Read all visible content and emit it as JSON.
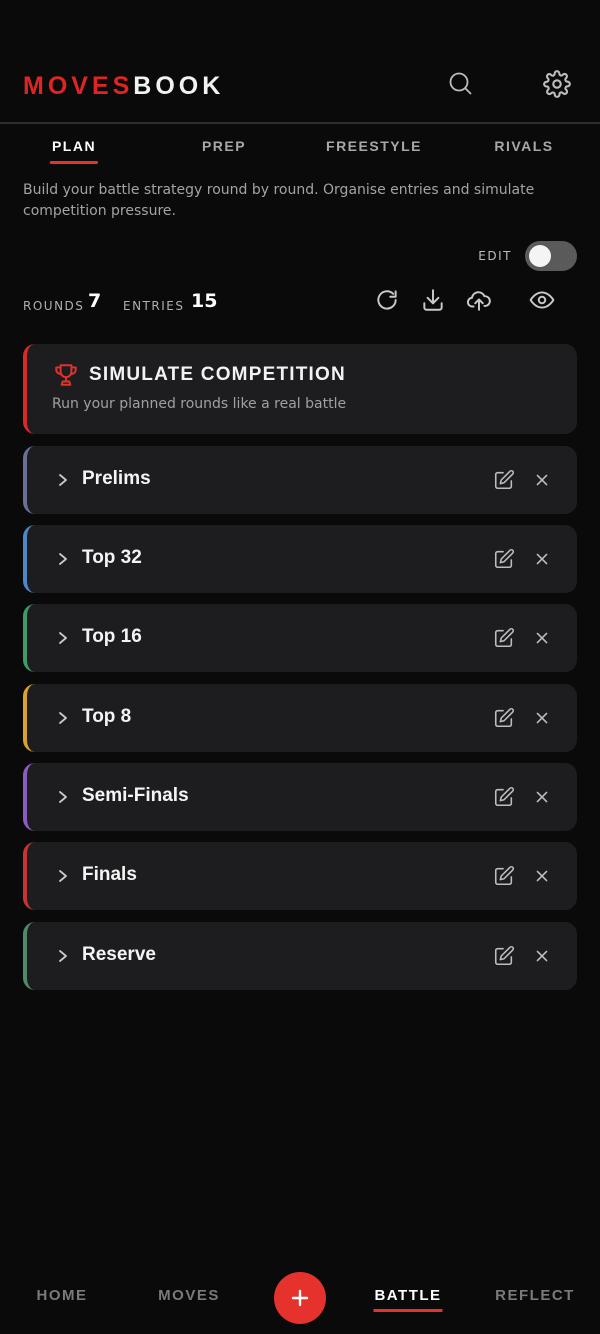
{
  "app": {
    "logo_part1": "MOVES",
    "logo_part2": "BOOK"
  },
  "header_icons": [
    "search-icon",
    "gear-icon"
  ],
  "tabs": [
    {
      "label": "PLAN",
      "active": true
    },
    {
      "label": "PREP",
      "active": false
    },
    {
      "label": "FREESTYLE",
      "active": false
    },
    {
      "label": "RIVALS",
      "active": false
    }
  ],
  "description": "Build your battle strategy round by round. Organise entries and simulate competition pressure.",
  "edit_toggle": {
    "label": "EDIT",
    "on": false
  },
  "stats": {
    "rounds_label": "ROUNDS",
    "rounds_value": "7",
    "entries_label": "ENTRIES",
    "entries_value": "15"
  },
  "actions": [
    "refresh-icon",
    "download-icon",
    "upload-icon",
    "eye-icon"
  ],
  "simulate": {
    "title": "SIMULATE COMPETITION",
    "subtitle": "Run your planned rounds like a real battle",
    "accent": "#d42a2a"
  },
  "rounds": [
    {
      "name": "Prelims",
      "accent": "#6a6f96"
    },
    {
      "name": "Top 32",
      "accent": "#4f86c6"
    },
    {
      "name": "Top 16",
      "accent": "#3f9b6a"
    },
    {
      "name": "Top 8",
      "accent": "#d9a12f"
    },
    {
      "name": "Semi-Finals",
      "accent": "#8a5cc2"
    },
    {
      "name": "Finals",
      "accent": "#c73434"
    },
    {
      "name": "Reserve",
      "accent": "#4f8a69"
    }
  ],
  "bottom_nav": [
    {
      "label": "HOME",
      "active": false
    },
    {
      "label": "MOVES",
      "active": false
    },
    {
      "label": "BATTLE",
      "active": true
    },
    {
      "label": "REFLECT",
      "active": false
    }
  ],
  "colors": {
    "brand_red": "#e5322d",
    "background": "#0a0a0a",
    "card": "#1d1d20"
  }
}
